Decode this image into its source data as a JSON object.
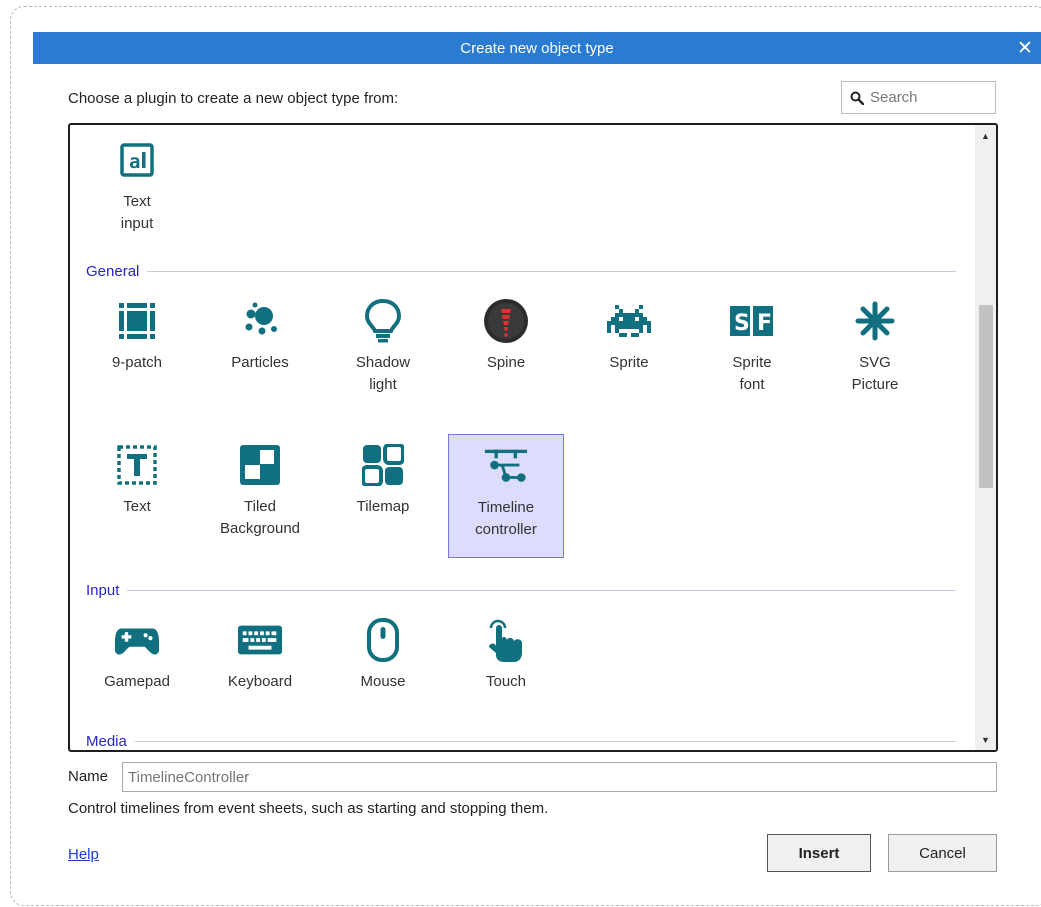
{
  "dialog": {
    "title": "Create new object type",
    "prompt": "Choose a plugin to create a new object type from:",
    "search_placeholder": "Search",
    "name_label": "Name",
    "name_placeholder": "TimelineController",
    "description": "Control timelines from event sheets, such as starting and stopping them.",
    "help_label": "Help",
    "insert_label": "Insert",
    "cancel_label": "Cancel"
  },
  "plugins": {
    "top": [
      {
        "label": "Text\ninput",
        "icon": "text-input-icon"
      }
    ],
    "categories": [
      {
        "name": "General"
      },
      {
        "name": "Input"
      },
      {
        "name": "Media"
      }
    ],
    "general": [
      {
        "label": "9-patch",
        "icon": "nine-patch-icon"
      },
      {
        "label": "Particles",
        "icon": "particles-icon"
      },
      {
        "label": "Shadow\nlight",
        "icon": "lightbulb-icon"
      },
      {
        "label": "Spine",
        "icon": "spine-icon"
      },
      {
        "label": "Sprite",
        "icon": "space-invader-icon"
      },
      {
        "label": "Sprite\nfont",
        "icon": "sprite-font-icon"
      },
      {
        "label": "SVG\nPicture",
        "icon": "svg-asterisk-icon"
      },
      {
        "label": "Text",
        "icon": "text-icon"
      },
      {
        "label": "Tiled\nBackground",
        "icon": "tiled-background-icon"
      },
      {
        "label": "Tilemap",
        "icon": "tilemap-icon"
      },
      {
        "label": "Timeline\ncontroller",
        "icon": "timeline-icon",
        "selected": true
      }
    ],
    "input": [
      {
        "label": "Gamepad",
        "icon": "gamepad-icon"
      },
      {
        "label": "Keyboard",
        "icon": "keyboard-icon"
      },
      {
        "label": "Mouse",
        "icon": "mouse-icon"
      },
      {
        "label": "Touch",
        "icon": "touch-icon"
      }
    ]
  },
  "colors": {
    "title_bar": "#2b7bd1",
    "icon_teal": "#11707f",
    "category_text": "#2626c6",
    "selected_bg": "#dcdcfc"
  }
}
